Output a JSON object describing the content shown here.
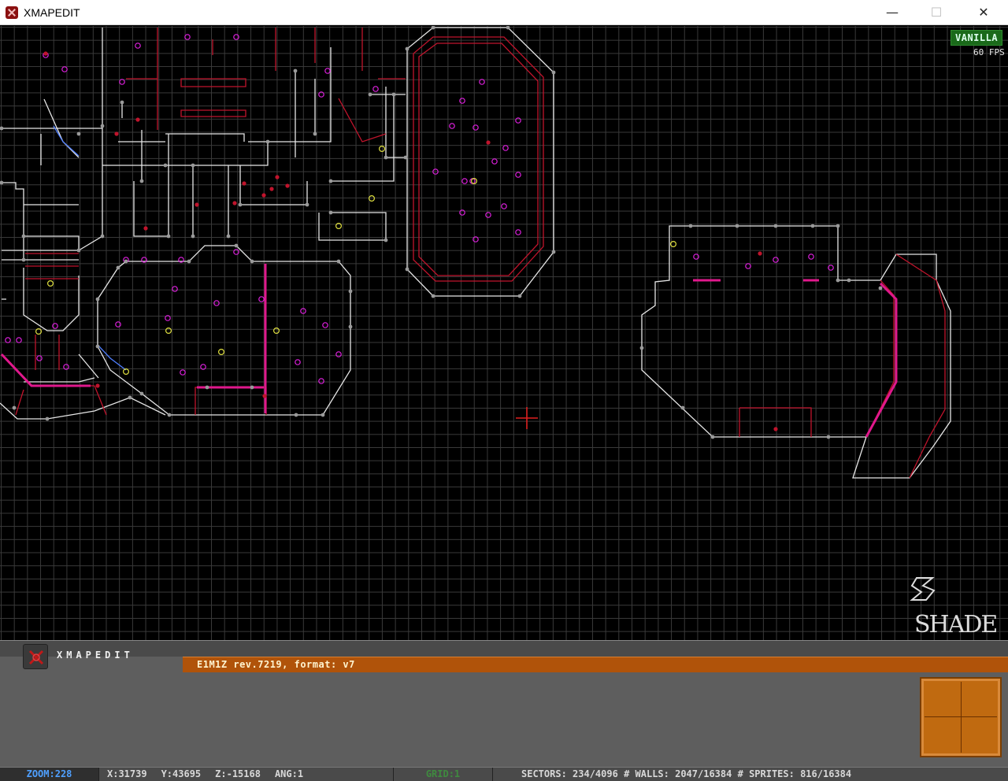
{
  "window": {
    "title": "XMAPEDIT",
    "controls": {
      "minimize": "—",
      "maximize": "☐",
      "close": "✕"
    }
  },
  "viewport": {
    "mode_badge": "VANILLA",
    "fps": "60 FPS",
    "watermark": "SHADE"
  },
  "panel": {
    "brand": "XMAPEDIT",
    "map_info": "E1M1Z rev.7219, format: v7"
  },
  "status": {
    "zoom": "ZOOM:228",
    "x": "X:31739",
    "y": "Y:43695",
    "z": "Z:-15168",
    "ang": "ANG:1",
    "grid": "GRID:1",
    "sectors": "SECTORS: 234/4096",
    "walls": "WALLS: 2047/16384",
    "sprites": "SPRITES: 816/16384",
    "separator": "#"
  },
  "colors": {
    "grid": "#3a3a3a",
    "wall_white": "#e6e6e6",
    "wall_red": "#c0142c",
    "sprite_magenta": "#e020e0",
    "sprite_yellow": "#e0e040",
    "vertex": "#9a9a9a",
    "info_bar": "#b0530a",
    "badge": "#1a6a1a",
    "status_zoom": "#4fa0ff",
    "status_grid": "#3f8a3f"
  },
  "icons": {
    "app": "xmapedit-app-icon",
    "crosshair": "red-crosshair-cursor"
  }
}
